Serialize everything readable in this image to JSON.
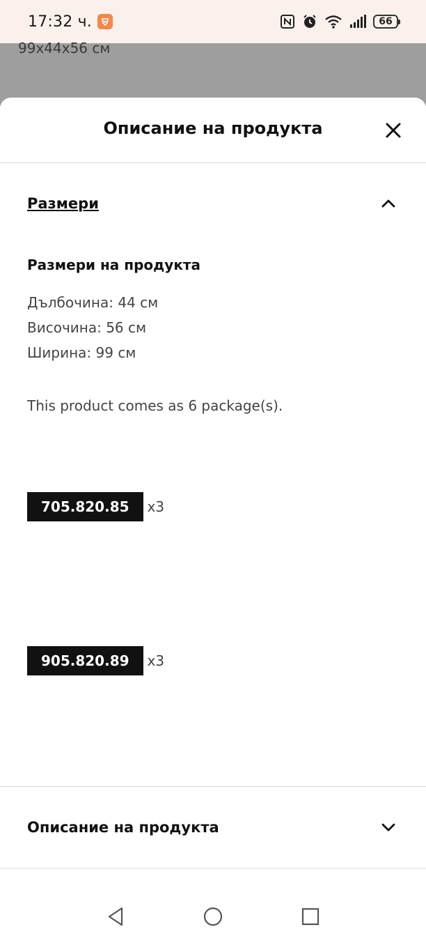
{
  "status_bar": {
    "time": "17:32 ч.",
    "battery": "66",
    "icons": [
      "brave-icon",
      "nfc-icon",
      "alarm-icon",
      "wifi-icon",
      "signal-icon",
      "battery-icon"
    ]
  },
  "backdrop": {
    "dimensions_text": "99x44x56 см"
  },
  "sheet": {
    "title": "Описание на продукта",
    "close_icon": "close-icon",
    "section": {
      "label": "Размери",
      "expanded": true,
      "sub_heading": "Размери на продукта",
      "dimensions": [
        "Дълбочина: 44 см",
        "Височина: 56 см",
        "Ширина: 99 см"
      ],
      "package_note": "This product comes as 6 package(s).",
      "packages": [
        {
          "code": "705.820.85",
          "qty": "x3"
        },
        {
          "code": "905.820.89",
          "qty": "x3"
        }
      ]
    },
    "collapsed_section": {
      "label": "Описание на продукта",
      "expanded": false
    }
  },
  "nav": {
    "icons": [
      "back-icon",
      "home-icon",
      "recents-icon"
    ]
  },
  "colors": {
    "status_bar_bg": "#fbf1ec",
    "backdrop": "#9e9e9e",
    "brave_accent": "#f4874b",
    "code_badge_bg": "#111111"
  }
}
